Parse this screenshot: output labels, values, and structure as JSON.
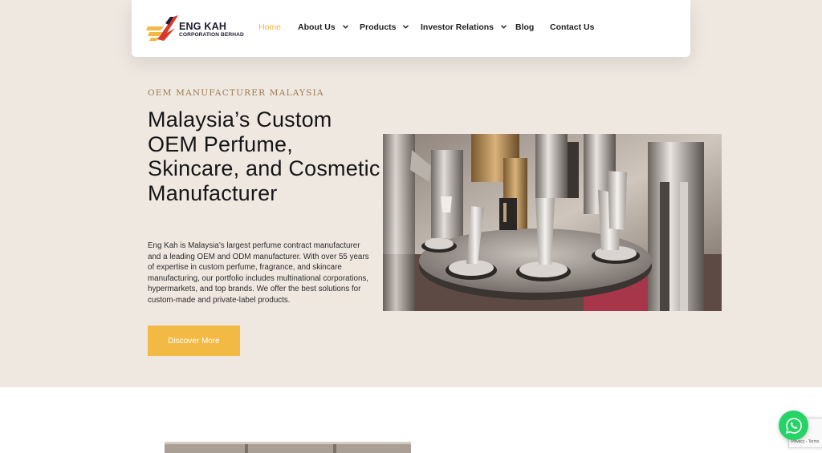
{
  "brand": {
    "name": "ENG KAH",
    "subtitle": "CORPORATION BERHAD",
    "colors": {
      "red": "#d63a2b",
      "gold": "#f2b944",
      "navy": "#1f1a2e"
    }
  },
  "nav": {
    "items": [
      {
        "label": "Home",
        "active": true,
        "has_dropdown": false
      },
      {
        "label": "About Us",
        "active": false,
        "has_dropdown": true
      },
      {
        "label": "Products",
        "active": false,
        "has_dropdown": true
      },
      {
        "label": "Investor Relations",
        "active": false,
        "has_dropdown": true
      },
      {
        "label": "Blog",
        "active": false,
        "has_dropdown": false
      },
      {
        "label": "Contact Us",
        "active": false,
        "has_dropdown": false
      }
    ],
    "active_color": "#f0b43f"
  },
  "hero": {
    "eyebrow": "OEM MANUFACTURER MALAYSIA",
    "headline": "Malaysia’s Custom OEM Perfume, Skincare, and Cosmetic Manufacturer",
    "description": "Eng Kah is Malaysia’s largest perfume contract manufacturer and a leading OEM and ODM manufacturer. With over 55 years of expertise in custom perfume, fragrance, and skincare manufacturing, our portfolio includes multinational corporations, hypermarkets, and top brands. We offer the best solutions for custom-made and private-label products.",
    "cta_label": "Discover More",
    "image": "tube-filling-machine-photo",
    "background": "#efe8e1"
  },
  "floating": {
    "whatsapp_icon": "whatsapp-icon",
    "recaptcha_text": "Privacy - Terms"
  }
}
